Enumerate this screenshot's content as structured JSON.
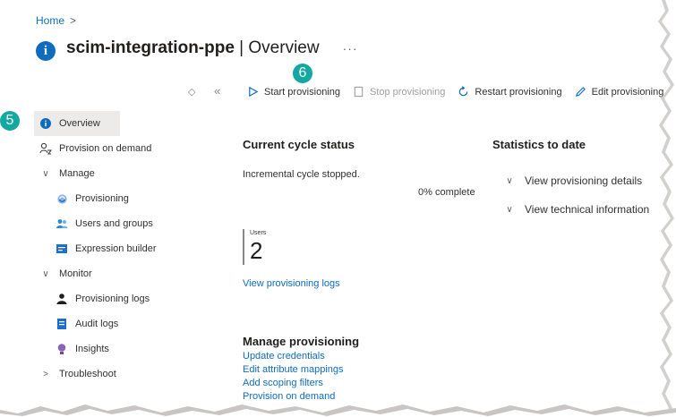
{
  "breadcrumb": {
    "home": "Home",
    "separator": ">"
  },
  "header": {
    "name": "scim-integration-ppe",
    "separator": " | ",
    "section": "Overview",
    "more": "···"
  },
  "callouts": {
    "five": "5",
    "six": "6"
  },
  "sidebar": {
    "collapse_left": "◇",
    "collapse_arrows": "«",
    "items": [
      {
        "label": "Overview",
        "icon": "info-icon"
      },
      {
        "label": "Provision on demand",
        "icon": "provision-on-demand-icon"
      },
      {
        "label": "Manage",
        "icon": "chevron-down-icon"
      },
      {
        "label": "Provisioning",
        "icon": "provisioning-icon"
      },
      {
        "label": "Users and groups",
        "icon": "users-icon"
      },
      {
        "label": "Expression builder",
        "icon": "expression-icon"
      },
      {
        "label": "Monitor",
        "icon": "chevron-down-icon"
      },
      {
        "label": "Provisioning logs",
        "icon": "logs-icon"
      },
      {
        "label": "Audit logs",
        "icon": "audit-icon"
      },
      {
        "label": "Insights",
        "icon": "insights-icon"
      },
      {
        "label": "Troubleshoot",
        "icon": "chevron-right-icon"
      }
    ]
  },
  "toolbar": {
    "start": "Start provisioning",
    "stop": "Stop provisioning",
    "restart": "Restart provisioning",
    "edit": "Edit provisioning"
  },
  "cycle": {
    "heading": "Current cycle status",
    "status": "Incremental cycle stopped.",
    "progress_text": "0% complete",
    "progress": 0
  },
  "users": {
    "label": "Users",
    "count": "2",
    "logs_link": "View provisioning logs"
  },
  "stats": {
    "heading": "Statistics to date",
    "details": "View provisioning details",
    "technical": "View technical information"
  },
  "manage": {
    "heading": "Manage provisioning",
    "links": [
      "Update credentials",
      "Edit attribute mappings",
      "Add scoping filters",
      "Provision on demand"
    ]
  },
  "colors": {
    "accent": "#0f6cbd",
    "callout": "#13a8a0",
    "active_bg": "#edebe9"
  }
}
